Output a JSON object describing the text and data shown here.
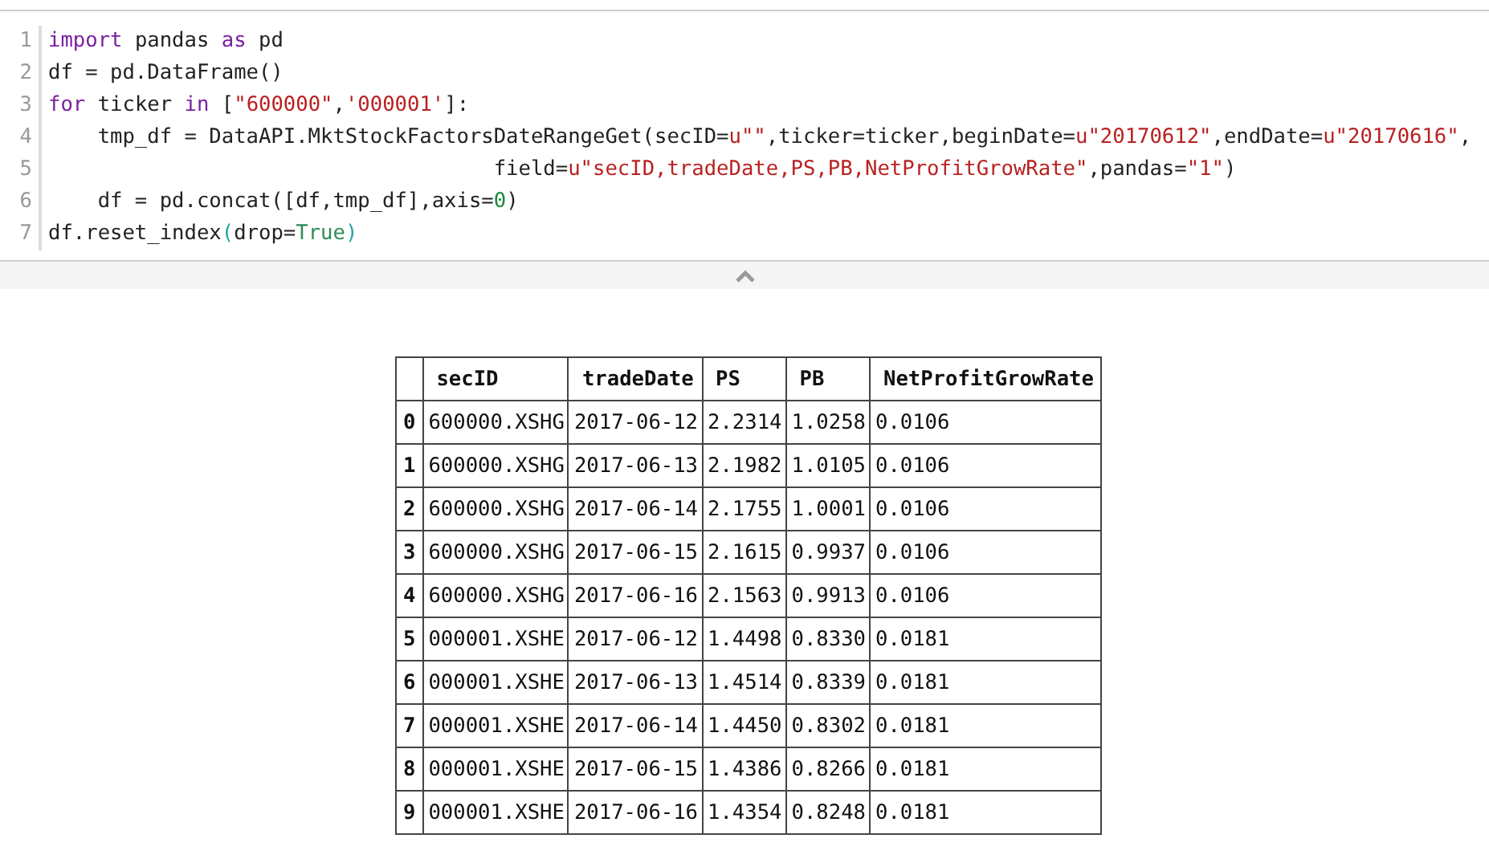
{
  "code_cell": {
    "lines": [
      {
        "number": "1",
        "tokens": [
          {
            "text": "import",
            "kind": "keyword"
          },
          {
            "text": " pandas ",
            "kind": "plain"
          },
          {
            "text": "as",
            "kind": "keyword"
          },
          {
            "text": " pd",
            "kind": "plain"
          }
        ]
      },
      {
        "number": "2",
        "tokens": [
          {
            "text": "df = pd.DataFrame()",
            "kind": "plain"
          }
        ]
      },
      {
        "number": "3",
        "tokens": [
          {
            "text": "for",
            "kind": "keyword"
          },
          {
            "text": " ticker ",
            "kind": "plain"
          },
          {
            "text": "in",
            "kind": "keyword"
          },
          {
            "text": " [",
            "kind": "plain"
          },
          {
            "text": "\"600000\"",
            "kind": "string"
          },
          {
            "text": ",",
            "kind": "plain"
          },
          {
            "text": "'000001'",
            "kind": "string"
          },
          {
            "text": "]:",
            "kind": "plain"
          }
        ]
      },
      {
        "number": "4",
        "tokens": [
          {
            "text": "    tmp_df = DataAPI.MktStockFactorsDateRangeGet(secID=",
            "kind": "plain"
          },
          {
            "text": "u\"\"",
            "kind": "string"
          },
          {
            "text": ",ticker=ticker,beginDate=",
            "kind": "plain"
          },
          {
            "text": "u\"20170612\"",
            "kind": "string"
          },
          {
            "text": ",endDate=",
            "kind": "plain"
          },
          {
            "text": "u\"20170616\"",
            "kind": "string"
          },
          {
            "text": ",",
            "kind": "plain"
          }
        ]
      },
      {
        "number": "5",
        "tokens": [
          {
            "text": "                                    field=",
            "kind": "plain"
          },
          {
            "text": "u\"secID,tradeDate,PS,PB,NetProfitGrowRate\"",
            "kind": "string"
          },
          {
            "text": ",pandas=",
            "kind": "plain"
          },
          {
            "text": "\"1\"",
            "kind": "string"
          },
          {
            "text": ")",
            "kind": "plain"
          }
        ]
      },
      {
        "number": "6",
        "tokens": [
          {
            "text": "    df = pd.concat([df,tmp_df],axis=",
            "kind": "plain"
          },
          {
            "text": "0",
            "kind": "number"
          },
          {
            "text": ")",
            "kind": "plain"
          }
        ]
      },
      {
        "number": "7",
        "tokens": [
          {
            "text": "df.reset_index",
            "kind": "plain"
          },
          {
            "text": "(",
            "kind": "bracket"
          },
          {
            "text": "drop=",
            "kind": "plain"
          },
          {
            "text": "True",
            "kind": "literal"
          },
          {
            "text": ")",
            "kind": "bracket"
          }
        ]
      }
    ]
  },
  "output_table": {
    "columns": [
      "secID",
      "tradeDate",
      "PS",
      "PB",
      "NetProfitGrowRate"
    ],
    "rows": [
      {
        "index": "0",
        "cells": [
          "600000.XSHG",
          "2017-06-12",
          "2.2314",
          "1.0258",
          "0.0106"
        ]
      },
      {
        "index": "1",
        "cells": [
          "600000.XSHG",
          "2017-06-13",
          "2.1982",
          "1.0105",
          "0.0106"
        ]
      },
      {
        "index": "2",
        "cells": [
          "600000.XSHG",
          "2017-06-14",
          "2.1755",
          "1.0001",
          "0.0106"
        ]
      },
      {
        "index": "3",
        "cells": [
          "600000.XSHG",
          "2017-06-15",
          "2.1615",
          "0.9937",
          "0.0106"
        ]
      },
      {
        "index": "4",
        "cells": [
          "600000.XSHG",
          "2017-06-16",
          "2.1563",
          "0.9913",
          "0.0106"
        ]
      },
      {
        "index": "5",
        "cells": [
          "000001.XSHE",
          "2017-06-12",
          "1.4498",
          "0.8330",
          "0.0181"
        ]
      },
      {
        "index": "6",
        "cells": [
          "000001.XSHE",
          "2017-06-13",
          "1.4514",
          "0.8339",
          "0.0181"
        ]
      },
      {
        "index": "7",
        "cells": [
          "000001.XSHE",
          "2017-06-14",
          "1.4450",
          "0.8302",
          "0.0181"
        ]
      },
      {
        "index": "8",
        "cells": [
          "000001.XSHE",
          "2017-06-15",
          "1.4386",
          "0.8266",
          "0.0181"
        ]
      },
      {
        "index": "9",
        "cells": [
          "000001.XSHE",
          "2017-06-16",
          "1.4354",
          "0.8248",
          "0.0181"
        ]
      }
    ]
  }
}
